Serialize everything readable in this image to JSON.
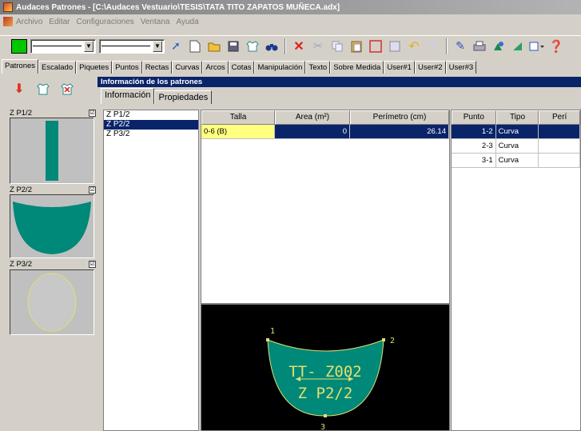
{
  "window": {
    "title": "Audaces Patrones - [C:\\Audaces Vestuario\\TESIS\\TATA TITO ZAPATOS MUÑECA.adx]"
  },
  "menu": [
    "Archivo",
    "Editar",
    "Configuraciones",
    "Ventana",
    "Ayuda"
  ],
  "colors": {
    "accent": "#00c800",
    "selection": "#0a246a",
    "piece_fill": "#008878",
    "piece_outline": "#e0e070",
    "highlight": "#ffff80"
  },
  "tabs": [
    "Patrones",
    "Escalado",
    "Piquetes",
    "Puntos",
    "Rectas",
    "Curvas",
    "Arcos",
    "Cotas",
    "Manipulación",
    "Texto",
    "Sobre Medida",
    "User#1",
    "User#2",
    "User#3"
  ],
  "info_bar": "Información de los patrones",
  "subtabs": [
    "Información",
    "Propiedades"
  ],
  "pieces": [
    {
      "name": "Z P1/2",
      "checked": "☑"
    },
    {
      "name": "Z P2/2",
      "checked": "☑"
    },
    {
      "name": "Z P3/2",
      "checked": "☑"
    }
  ],
  "pieces_list": [
    "Z P1/2",
    "Z P2/2",
    "Z P3/2"
  ],
  "size_table": {
    "headers": [
      "Talla",
      "Area (m²)",
      "Perímetro (cm)"
    ],
    "rows": [
      {
        "talla": "0-6 (B)",
        "area": "0",
        "perimetro": "26.14"
      }
    ]
  },
  "points_table": {
    "headers": [
      "Punto",
      "Tipo",
      "Perí"
    ],
    "rows": [
      {
        "punto": "1-2",
        "tipo": "Curva"
      },
      {
        "punto": "2-3",
        "tipo": "Curva"
      },
      {
        "punto": "3-1",
        "tipo": "Curva"
      }
    ]
  },
  "preview": {
    "line1": "TT- Z002",
    "line2": "Z P2/2",
    "point_labels": [
      "1",
      "2",
      "3"
    ]
  }
}
